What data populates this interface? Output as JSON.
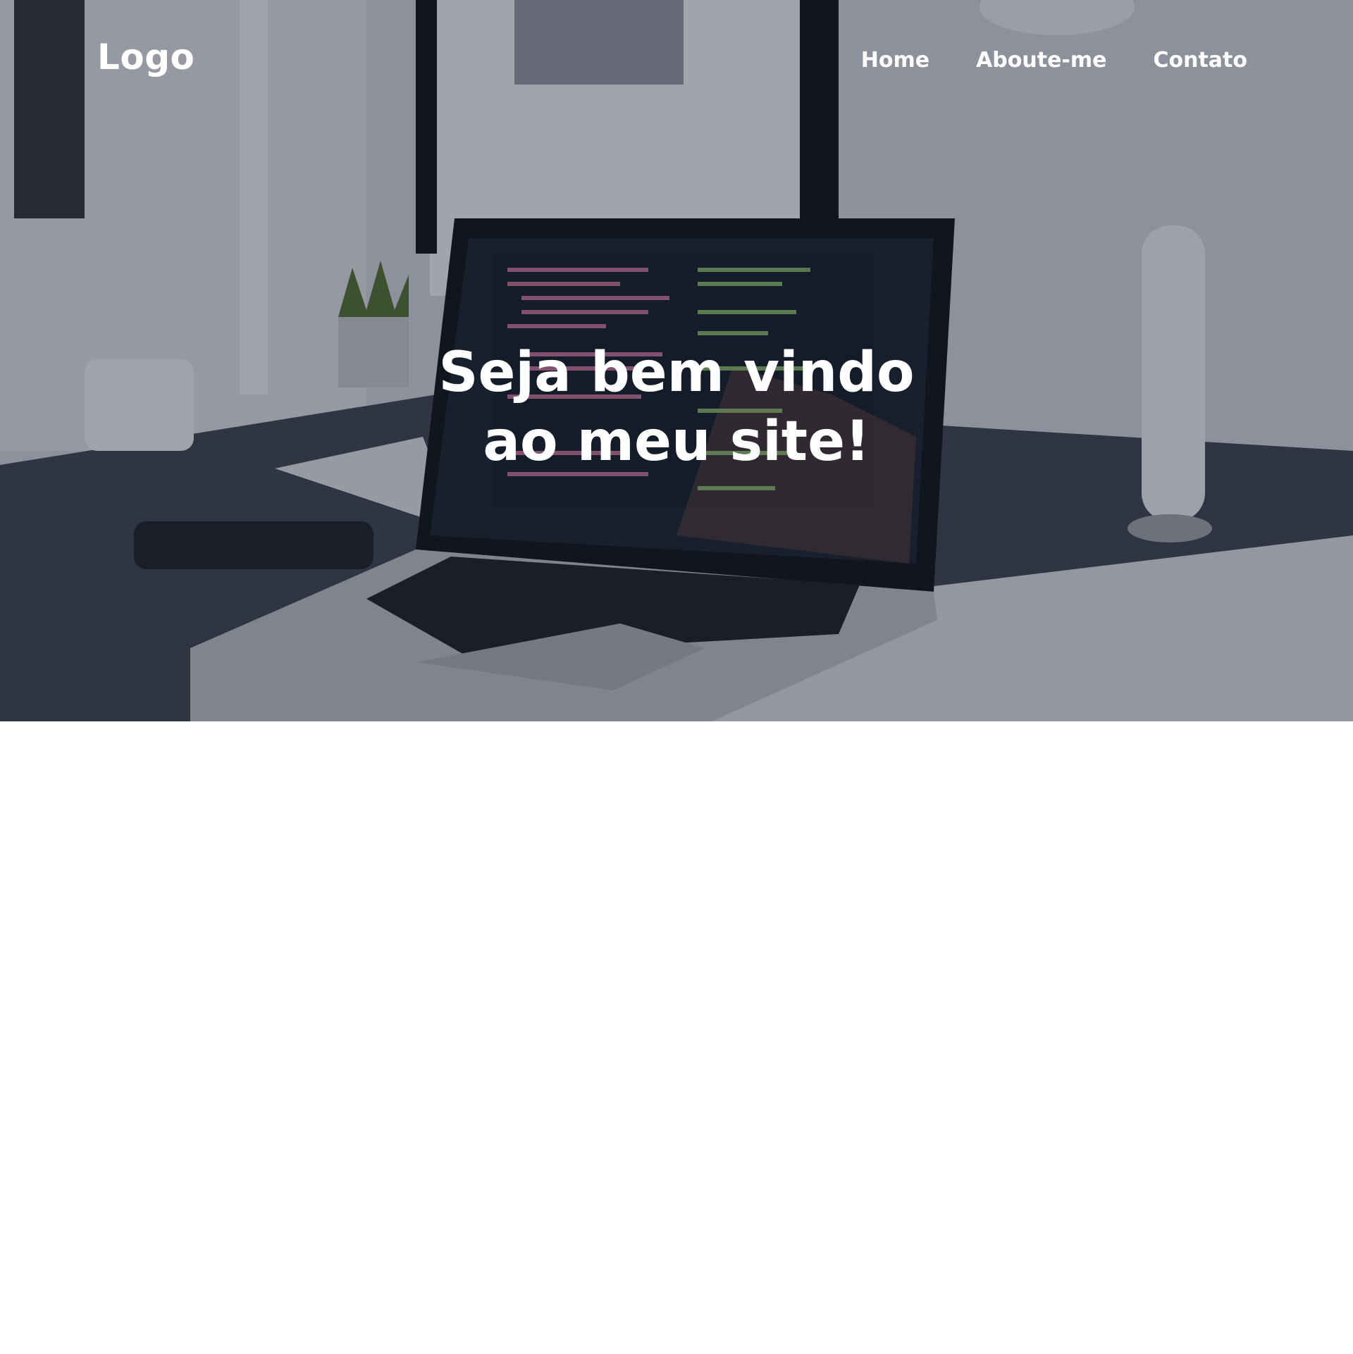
{
  "header": {
    "logo": "Logo",
    "nav": [
      {
        "label": "Home"
      },
      {
        "label": "Aboute-me"
      },
      {
        "label": "Contato"
      }
    ]
  },
  "hero": {
    "title_line1": "Seja bem vindo",
    "title_line2": "ao meu site!",
    "overlay_color": "#1e2234"
  }
}
